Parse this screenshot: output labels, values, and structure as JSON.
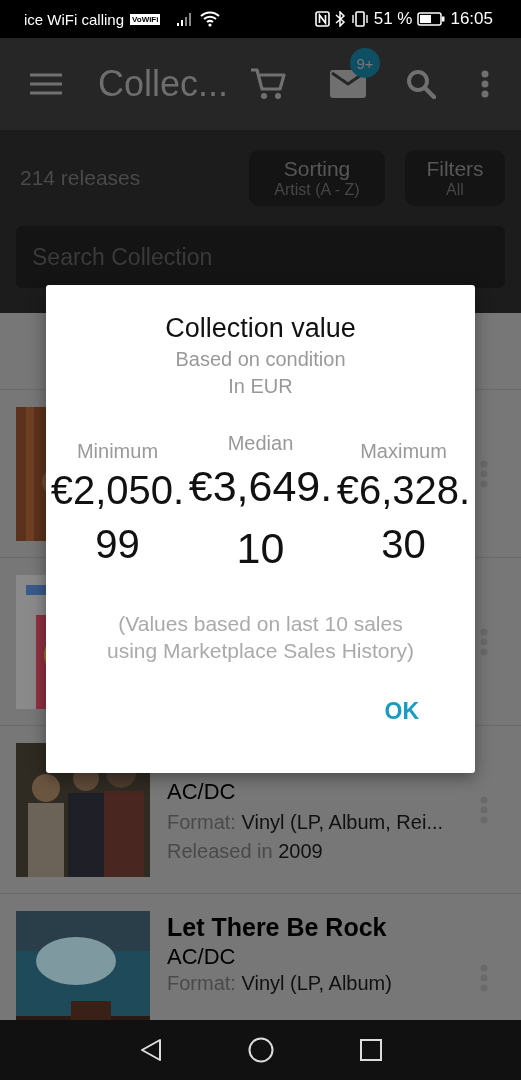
{
  "status_bar": {
    "carrier": "ice WiFi calling",
    "vowifi_badge": "VoWiFi",
    "battery_percent": "51 %",
    "time": "16:05"
  },
  "app_bar": {
    "title": "Collec...",
    "mail_badge": "9+"
  },
  "toolbar": {
    "count": "214 releases",
    "sorting": {
      "label": "Sorting",
      "value": "Artist (A - Z)"
    },
    "filters": {
      "label": "Filters",
      "value": "All"
    }
  },
  "search": {
    "placeholder": "Search Collection"
  },
  "releases": [
    {
      "cover": {
        "kind": "picture"
      }
    },
    {
      "cover": {
        "kind": "picture"
      }
    },
    {
      "cover": {
        "kind": "picture"
      },
      "artist": "AC/DC",
      "format_label": "Format:",
      "format": "Vinyl (LP, Album, Rei...",
      "released_label": "Released in",
      "year": "2009"
    },
    {
      "cover": {
        "kind": "picture"
      },
      "title": "Let There Be Rock",
      "artist": "AC/DC",
      "format_label": "Format:",
      "format": "Vinyl (LP, Album)"
    }
  ],
  "dialog": {
    "title": "Collection value",
    "subtitle": "Based on condition",
    "currency": "In EUR",
    "stats": [
      {
        "kind": "side",
        "label": "Minimum",
        "value": "€2,050.99"
      },
      {
        "kind": "center",
        "label": "Median",
        "value": "€3,649.10"
      },
      {
        "kind": "side",
        "label": "Maximum",
        "value": "€6,328.30"
      }
    ],
    "note": "(Values based on last 10 sales using Marketplace Sales History)",
    "button": "OK"
  }
}
